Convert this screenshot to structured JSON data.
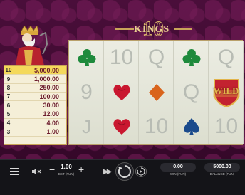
{
  "game": {
    "logo_top": "10",
    "logo_text": "KINGS"
  },
  "paytable": [
    {
      "n": "10",
      "value": "5,000.00",
      "active": true
    },
    {
      "n": "9",
      "value": "1,000.00",
      "active": false
    },
    {
      "n": "8",
      "value": "250.00",
      "active": false
    },
    {
      "n": "7",
      "value": "100.00",
      "active": false
    },
    {
      "n": "6",
      "value": "30.00",
      "active": false
    },
    {
      "n": "5",
      "value": "12.00",
      "active": false
    },
    {
      "n": "4",
      "value": "4.00",
      "active": false
    },
    {
      "n": "3",
      "value": "1.00",
      "active": false
    }
  ],
  "reels": [
    [
      "club",
      "9",
      "J"
    ],
    [
      "10",
      "heart",
      "heart"
    ],
    [
      "Q",
      "diamond",
      "10"
    ],
    [
      "club",
      "Q",
      "spade"
    ],
    [
      "Q",
      "WILD",
      "10"
    ]
  ],
  "colors": {
    "club": "#1e8a3c",
    "spade": "#1a4a8c",
    "heart": "#c9172f",
    "diamond": "#d9641c",
    "wild_red": "#c32230",
    "wild_gold": "#e2b44a"
  },
  "footer": {
    "bet_value": "1.00",
    "bet_label": "BET (FUN)",
    "win_value": "0.00",
    "win_label": "WIN (FUN)",
    "balance_value": "5000.00",
    "balance_label": "BALANCE (FUN)",
    "minus": "−",
    "plus": "+"
  }
}
